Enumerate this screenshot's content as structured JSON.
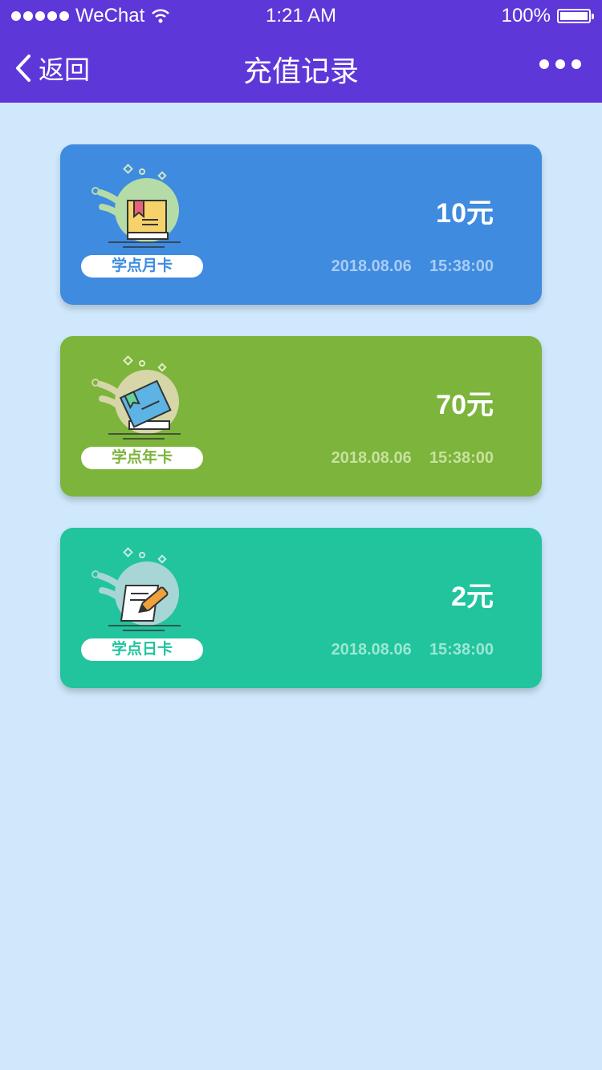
{
  "status": {
    "carrier": "WeChat",
    "time": "1:21 AM",
    "battery": "100%"
  },
  "nav": {
    "back_label": "返回",
    "title": "充值记录"
  },
  "colors": {
    "nav_bg": "#5e37d9",
    "page_bg": "#cfe8fb"
  },
  "records": [
    {
      "card_type": "学点月卡",
      "amount": "10元",
      "date": "2018.08.06",
      "time": "15:38:00",
      "bg": "#3f8be0",
      "accent": "#3f8be0",
      "date_color": "#a9cdf4",
      "icon": "book-bookmark-icon"
    },
    {
      "card_type": "学点年卡",
      "amount": "70元",
      "date": "2018.08.06",
      "time": "15:38:00",
      "bg": "#7cb43c",
      "accent": "#7cb43c",
      "date_color": "#c7e29c",
      "icon": "book-stack-icon"
    },
    {
      "card_type": "学点日卡",
      "amount": "2元",
      "date": "2018.08.06",
      "time": "15:38:00",
      "bg": "#21c49d",
      "accent": "#21c49d",
      "date_color": "#9be8d2",
      "icon": "pen-paper-icon"
    }
  ]
}
